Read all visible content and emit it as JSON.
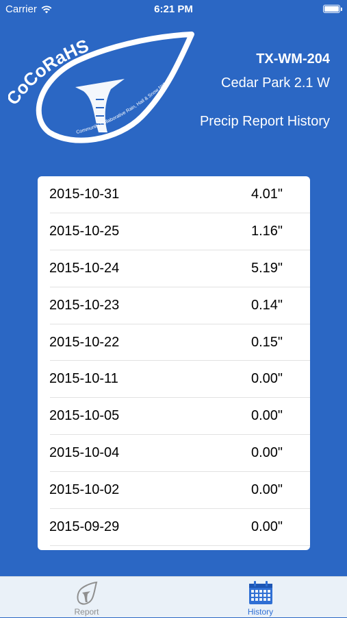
{
  "status_bar": {
    "carrier": "Carrier",
    "time": "6:21 PM"
  },
  "header": {
    "logo_text": "CoCoRaHS",
    "logo_tagline": "Community Collaborative Rain, Hail & Snow Network",
    "station_id": "TX-WM-204",
    "station_name": "Cedar Park 2.1 W",
    "report_title": "Precip Report History"
  },
  "history": [
    {
      "date": "2015-10-31",
      "amount": "4.01\""
    },
    {
      "date": "2015-10-25",
      "amount": "1.16\""
    },
    {
      "date": "2015-10-24",
      "amount": "5.19\""
    },
    {
      "date": "2015-10-23",
      "amount": "0.14\""
    },
    {
      "date": "2015-10-22",
      "amount": "0.15\""
    },
    {
      "date": "2015-10-11",
      "amount": "0.00\""
    },
    {
      "date": "2015-10-05",
      "amount": "0.00\""
    },
    {
      "date": "2015-10-04",
      "amount": "0.00\""
    },
    {
      "date": "2015-10-02",
      "amount": "0.00\""
    },
    {
      "date": "2015-09-29",
      "amount": "0.00\""
    }
  ],
  "tab_bar": {
    "report_label": "Report",
    "history_label": "History",
    "active_tab": "History"
  },
  "colors": {
    "background": "#2b67c4",
    "active_tab": "#2f6fd4",
    "inactive_tab": "#8f8f8f"
  },
  "icons": {
    "signal": "wifi-icon",
    "battery": "battery-icon",
    "report_tab": "raindrop-gauge-icon",
    "history_tab": "calendar-icon"
  }
}
